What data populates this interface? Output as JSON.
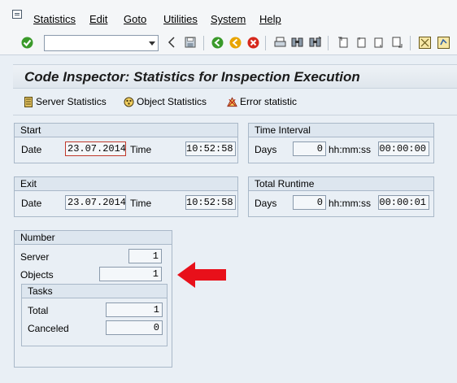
{
  "menu": {
    "items": [
      "Statistics",
      "Edit",
      "Goto",
      "Utilities",
      "System",
      "Help"
    ],
    "underline_index": [
      0,
      0,
      0,
      0,
      0,
      0
    ]
  },
  "toolbar": {
    "command_field_value": "",
    "icons": [
      "enter-icon",
      "back-icon",
      "save-icon",
      "back-green-icon",
      "exit-icon",
      "cancel-icon",
      "print-icon",
      "find-icon",
      "find-next-icon",
      "first-page-icon",
      "prev-page-icon",
      "next-page-icon",
      "last-page-icon",
      "layout-icon",
      "help-icon"
    ]
  },
  "title": "Code Inspector: Statistics for Inspection Execution",
  "app_toolbar": {
    "server_statistics": "Server Statistics",
    "object_statistics": "Object Statistics",
    "error_statistic": "Error statistic"
  },
  "start": {
    "header": "Start",
    "date_label": "Date",
    "date_value": "23.07.2014",
    "time_label": "Time",
    "time_value": "10:52:58"
  },
  "time_interval": {
    "header": "Time Interval",
    "days_label": "Days",
    "days_value": "0",
    "hms_label": "hh:mm:ss",
    "hms_value": "00:00:00"
  },
  "exit": {
    "header": "Exit",
    "date_label": "Date",
    "date_value": "23.07.2014",
    "time_label": "Time",
    "time_value": "10:52:58"
  },
  "total_runtime": {
    "header": "Total Runtime",
    "days_label": "Days",
    "days_value": "0",
    "hms_label": "hh:mm:ss",
    "hms_value": "00:00:01"
  },
  "number": {
    "header": "Number",
    "server_label": "Server",
    "server_value": "1",
    "objects_label": "Objects",
    "objects_value": "1"
  },
  "tasks": {
    "header": "Tasks",
    "total_label": "Total",
    "total_value": "1",
    "canceled_label": "Canceled",
    "canceled_value": "0"
  },
  "colors": {
    "background": "#e9eff5",
    "annotation_arrow": "#e8101a",
    "enter_green": "#3a9a2a",
    "exit_orange": "#e8a400",
    "cancel_red": "#d6281c"
  }
}
